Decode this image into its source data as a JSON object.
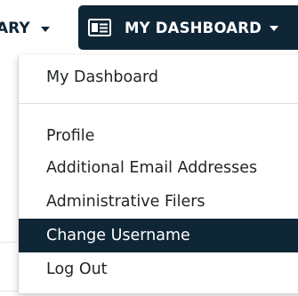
{
  "nav": {
    "previous_item_label": "ARY",
    "active_item_label": "MY DASHBOARD",
    "active_item_icon": "id-card-icon",
    "colors": {
      "nav_active_bg": "#0f2637",
      "nav_text": "#0f2637",
      "nav_active_text": "#ffffff"
    }
  },
  "dropdown": {
    "items": [
      {
        "label": "My Dashboard",
        "selected": false
      },
      {
        "label": "Profile",
        "selected": false
      },
      {
        "label": "Additional Email Addresses",
        "selected": false
      },
      {
        "label": "Administrative Filers",
        "selected": false
      },
      {
        "label": "Change Username",
        "selected": true
      },
      {
        "label": "Log Out",
        "selected": false
      }
    ],
    "colors": {
      "selected_bg": "#0f2637",
      "selected_text": "#ffffff",
      "item_text": "#1f2326"
    }
  }
}
